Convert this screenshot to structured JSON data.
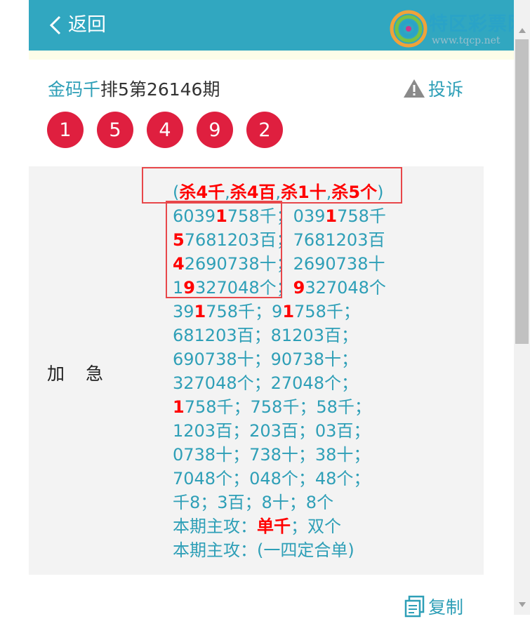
{
  "header": {
    "back_label": "返回"
  },
  "watermark": {
    "title": "特区彩票网",
    "url": "www.tqcp.net"
  },
  "title": {
    "source": "金码千",
    "issue": "排5第26146期"
  },
  "report_label": "投诉",
  "balls": [
    "1",
    "5",
    "4",
    "9",
    "2"
  ],
  "panel": {
    "label": "加急",
    "lines": [
      [
        {
          "t": "("
        },
        {
          "t": "杀4千",
          "r": true
        },
        {
          "t": ","
        },
        {
          "t": "杀4百",
          "r": true
        },
        {
          "t": ","
        },
        {
          "t": "杀1十",
          "r": true
        },
        {
          "t": ","
        },
        {
          "t": "杀5个",
          "r": true
        },
        {
          "t": ")"
        }
      ],
      [
        {
          "t": "6039"
        },
        {
          "t": "1",
          "r": true
        },
        {
          "t": "758千；039"
        },
        {
          "t": "1",
          "r": true
        },
        {
          "t": "758千"
        }
      ],
      [
        {
          "t": "5",
          "r": true
        },
        {
          "t": "7681203百；7681203百"
        }
      ],
      [
        {
          "t": "4",
          "r": true
        },
        {
          "t": "2690738十；2690738十"
        }
      ],
      [
        {
          "t": "1"
        },
        {
          "t": "9",
          "r": true
        },
        {
          "t": "327048个；"
        },
        {
          "t": "9",
          "r": true
        },
        {
          "t": "327048个"
        }
      ],
      [
        {
          "t": "39"
        },
        {
          "t": "1",
          "r": true
        },
        {
          "t": "758千；9"
        },
        {
          "t": "1",
          "r": true
        },
        {
          "t": "758千；"
        }
      ],
      [
        {
          "t": "681203百；81203百；"
        }
      ],
      [
        {
          "t": "690738十；90738十；"
        }
      ],
      [
        {
          "t": "327048个；27048个；"
        }
      ],
      [
        {
          "t": "1",
          "r": true
        },
        {
          "t": "758千；758千；58千；"
        }
      ],
      [
        {
          "t": "1203百；203百；03百；"
        }
      ],
      [
        {
          "t": "0738十；738十；38十；"
        }
      ],
      [
        {
          "t": "7048个；048个；48个；"
        }
      ],
      [
        {
          "t": "千8；3百；8十；8个"
        }
      ],
      [
        {
          "t": "本期主攻："
        },
        {
          "t": "单千",
          "r": true
        },
        {
          "t": "；双个"
        }
      ],
      [
        {
          "t": "本期主攻：(一四定合单)"
        }
      ]
    ]
  },
  "copy_label": "复制",
  "colors": {
    "header": "#31a7c0",
    "accent": "#2e9fb7",
    "ball": "#df1f3f",
    "highlight": "#ff0000"
  }
}
